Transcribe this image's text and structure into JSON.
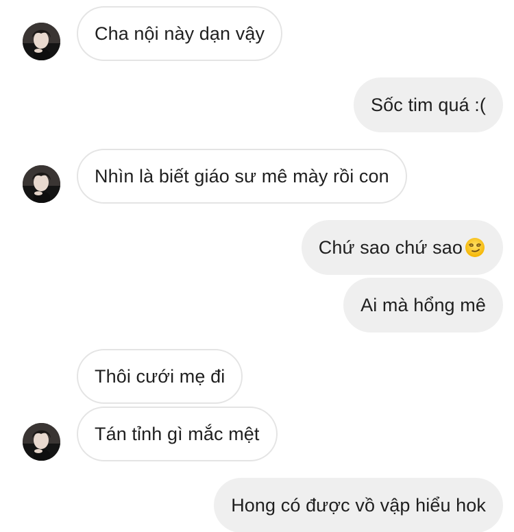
{
  "conversation": {
    "messages": [
      {
        "sender": "other",
        "text": "Cha nội này dạn vậy"
      },
      {
        "sender": "me",
        "text": "Sốc tim quá :("
      },
      {
        "sender": "other",
        "text": "Nhìn là biết giáo sư mê mày rồi con"
      },
      {
        "sender": "me",
        "text": "Chứ sao chứ sao",
        "emoji": "smirking-face-emoji"
      },
      {
        "sender": "me",
        "text": "Ai mà hổng mê"
      },
      {
        "sender": "other",
        "text": "Thôi cưới mẹ đi"
      },
      {
        "sender": "other",
        "text": "Tán tỉnh gì mắc mệt"
      },
      {
        "sender": "me",
        "text": "Hong có được vồ vập hiểu hok"
      }
    ]
  },
  "colors": {
    "incoming_bubble_bg": "#ffffff",
    "incoming_bubble_border": "#e4e4e4",
    "outgoing_bubble_bg": "#efefef",
    "text": "#1f1f1f"
  },
  "icons": {
    "avatar": "contact-avatar-photo",
    "emoji": "smirking-face-emoji"
  }
}
